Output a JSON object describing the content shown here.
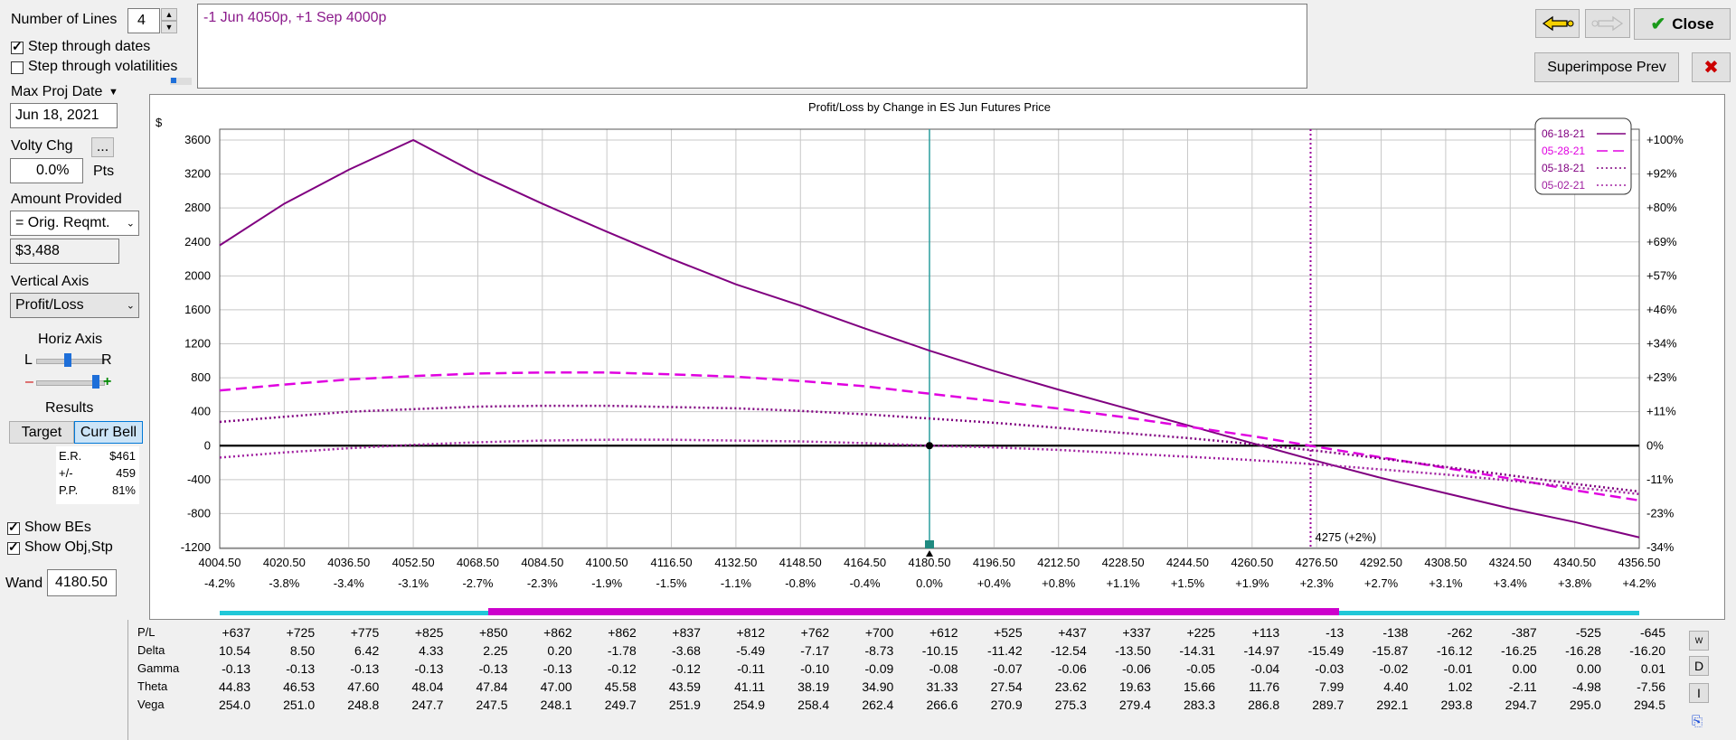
{
  "controls": {
    "num_lines_label": "Number of Lines",
    "num_lines_value": "4",
    "step_dates_label": "Step through dates",
    "step_dates_checked": true,
    "step_vols_label": "Step through volatilities",
    "step_vols_checked": false,
    "max_proj_date_label": "Max Proj Date",
    "max_proj_date_value": "Jun 18, 2021",
    "volty_chg_label": "Volty Chg",
    "volty_chg_value": "0.0%",
    "volty_chg_unit": "Pts",
    "ellipsis": "...",
    "amount_provided_label": "Amount Provided",
    "amount_provided_value": "= Orig. Reqmt.",
    "amount_value": "$3,488",
    "vertical_axis_label": "Vertical Axis",
    "vertical_axis_value": "Profit/Loss",
    "horiz_axis_label": "Horiz Axis",
    "horiz_l": "L",
    "horiz_r": "R",
    "horiz_minus": "–",
    "horiz_plus": "+",
    "results_label": "Results",
    "target_button": "Target",
    "curr_bell_button": "Curr Bell",
    "stats": [
      {
        "label": "E.R.",
        "value": "$461"
      },
      {
        "label": "+/-",
        "value": "459"
      },
      {
        "label": "P.P.",
        "value": "81%"
      }
    ],
    "show_bes_label": "Show BEs",
    "show_bes_checked": true,
    "show_obj_label": "Show Obj,Stp",
    "show_obj_checked": true,
    "wand_label": "Wand",
    "wand_value": "4180.50"
  },
  "position_text": "-1 Jun 4050p, +1 Sep 4000p",
  "toolbar": {
    "close_label": "Close",
    "superimpose_label": "Superimpose Prev",
    "close_x": "✖"
  },
  "colors": {
    "line_0618": "#800080",
    "line_0528": "#e000e0",
    "line_0518": "#800080",
    "line_0502": "#a020a0",
    "wand_line": "#2a9d9d",
    "magenta_bar": "#cc00cc",
    "cyan_bar": "#20c8d8"
  },
  "chart_data": {
    "type": "line",
    "title": "Profit/Loss by Change in ES Jun Futures Price",
    "ylabel": "$",
    "ylim": [
      -1200,
      3600
    ],
    "yticks": [
      -1200,
      -800,
      -400,
      0,
      400,
      800,
      1200,
      1600,
      2000,
      2400,
      2800,
      3200,
      3600
    ],
    "right_ticks": [
      "-34%",
      "-23%",
      "-11%",
      "0%",
      "+11%",
      "+23%",
      "+34%",
      "+46%",
      "+57%",
      "+69%",
      "+80%",
      "+92%",
      "+100%"
    ],
    "x": [
      4004.5,
      4020.5,
      4036.5,
      4052.5,
      4068.5,
      4084.5,
      4100.5,
      4116.5,
      4132.5,
      4148.5,
      4164.5,
      4180.5,
      4196.5,
      4212.5,
      4228.5,
      4244.5,
      4260.5,
      4276.5,
      4292.5,
      4308.5,
      4324.5,
      4340.5,
      4356.5
    ],
    "x_labels": [
      "4004.50",
      "4020.50",
      "4036.50",
      "4052.50",
      "4068.50",
      "4084.50",
      "4100.50",
      "4116.50",
      "4132.50",
      "4148.50",
      "4164.50",
      "4180.50",
      "4196.50",
      "4212.50",
      "4228.50",
      "4244.50",
      "4260.50",
      "4276.50",
      "4292.50",
      "4308.50",
      "4324.50",
      "4340.50",
      "4356.50"
    ],
    "x_pct_labels": [
      "-4.2%",
      "-3.8%",
      "-3.4%",
      "-3.1%",
      "-2.7%",
      "-2.3%",
      "-1.9%",
      "-1.5%",
      "-1.1%",
      "-0.8%",
      "-0.4%",
      "0.0%",
      "+0.4%",
      "+0.8%",
      "+1.1%",
      "+1.5%",
      "+1.9%",
      "+2.3%",
      "+2.7%",
      "+3.1%",
      "+3.4%",
      "+3.8%",
      "+4.2%"
    ],
    "xlim": [
      4004.5,
      4356.5
    ],
    "series": [
      {
        "name": "06-18-21",
        "style": "solid",
        "values": [
          2360,
          2850,
          3250,
          3600,
          3200,
          2850,
          2520,
          2200,
          1900,
          1650,
          1380,
          1120,
          880,
          660,
          450,
          240,
          30,
          -180,
          -380,
          -560,
          -740,
          -900,
          -1080
        ]
      },
      {
        "name": "05-28-21",
        "style": "dash",
        "values": [
          650,
          720,
          780,
          820,
          850,
          862,
          862,
          840,
          812,
          762,
          700,
          612,
          525,
          437,
          337,
          225,
          113,
          -13,
          -138,
          -262,
          -387,
          -525,
          -645
        ]
      },
      {
        "name": "05-18-21",
        "style": "dot",
        "values": [
          280,
          340,
          400,
          430,
          460,
          470,
          470,
          455,
          440,
          410,
          370,
          320,
          270,
          210,
          150,
          90,
          20,
          -60,
          -150,
          -250,
          -350,
          -450,
          -540
        ]
      },
      {
        "name": "05-02-21",
        "style": "dot",
        "values": [
          -140,
          -80,
          -30,
          10,
          40,
          60,
          70,
          70,
          60,
          50,
          30,
          0,
          -20,
          -50,
          -90,
          -130,
          -170,
          -220,
          -280,
          -340,
          -410,
          -490,
          -570
        ]
      }
    ],
    "wand_x": 4180.5,
    "target_x": 4275,
    "target_label": "4275 (+2%)",
    "legend_position": "top-right"
  },
  "greeks": {
    "row_labels": [
      "P/L",
      "Delta",
      "Gamma",
      "Theta",
      "Vega"
    ],
    "rows": [
      [
        "+637",
        "+725",
        "+775",
        "+825",
        "+850",
        "+862",
        "+862",
        "+837",
        "+812",
        "+762",
        "+700",
        "+612",
        "+525",
        "+437",
        "+337",
        "+225",
        "+113",
        "-13",
        "-138",
        "-262",
        "-387",
        "-525",
        "-645"
      ],
      [
        "10.54",
        "8.50",
        "6.42",
        "4.33",
        "2.25",
        "0.20",
        "-1.78",
        "-3.68",
        "-5.49",
        "-7.17",
        "-8.73",
        "-10.15",
        "-11.42",
        "-12.54",
        "-13.50",
        "-14.31",
        "-14.97",
        "-15.49",
        "-15.87",
        "-16.12",
        "-16.25",
        "-16.28",
        "-16.20"
      ],
      [
        "-0.13",
        "-0.13",
        "-0.13",
        "-0.13",
        "-0.13",
        "-0.13",
        "-0.12",
        "-0.12",
        "-0.11",
        "-0.10",
        "-0.09",
        "-0.08",
        "-0.07",
        "-0.06",
        "-0.06",
        "-0.05",
        "-0.04",
        "-0.03",
        "-0.02",
        "-0.01",
        "0.00",
        "0.00",
        "0.01"
      ],
      [
        "44.83",
        "46.53",
        "47.60",
        "48.04",
        "47.84",
        "47.00",
        "45.58",
        "43.59",
        "41.11",
        "38.19",
        "34.90",
        "31.33",
        "27.54",
        "23.62",
        "19.63",
        "15.66",
        "11.76",
        "7.99",
        "4.40",
        "1.02",
        "-2.11",
        "-4.98",
        "-7.56"
      ],
      [
        "254.0",
        "251.0",
        "248.8",
        "247.7",
        "247.5",
        "248.1",
        "249.7",
        "251.9",
        "254.9",
        "258.4",
        "262.4",
        "266.6",
        "270.9",
        "275.3",
        "279.4",
        "283.3",
        "286.8",
        "289.7",
        "292.1",
        "293.8",
        "294.7",
        "295.0",
        "294.5"
      ]
    ],
    "side_buttons": [
      "W",
      "D",
      "I"
    ]
  }
}
